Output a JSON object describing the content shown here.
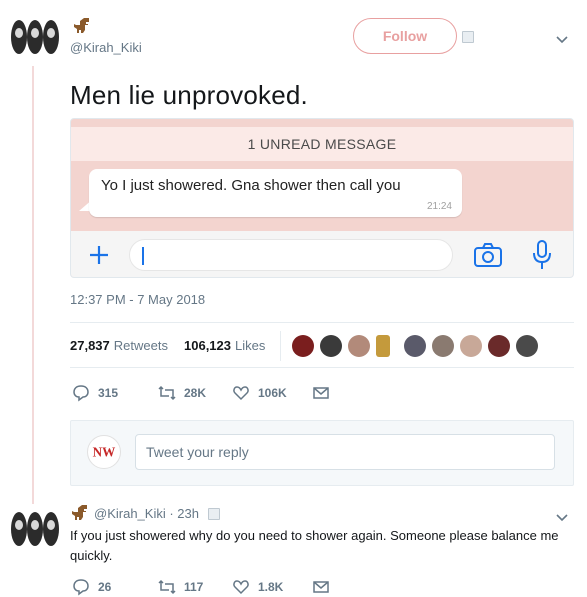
{
  "tweet": {
    "handle": "@Kirah_Kiki",
    "follow_label": "Follow",
    "text": "Men lie unprovoked.",
    "timestamp": "12:37 PM - 7 May 2018",
    "retweets_count": "27,837",
    "retweets_label": "Retweets",
    "likes_count": "106,123",
    "likes_label": "Likes",
    "actions": {
      "replies": "315",
      "retweets": "28K",
      "likes": "106K"
    }
  },
  "chat_image": {
    "unread_label": "1 UNREAD MESSAGE",
    "message": "Yo I just showered. Gna shower then call you",
    "message_time": "21:24"
  },
  "reply_box": {
    "placeholder": "Tweet your reply",
    "logo_text": "NW"
  },
  "reply_tweet": {
    "handle_line": "@Kirah_Kiki · 23h",
    "text": "If you just showered why do you need to shower again. Someone please balance me quickly.",
    "actions": {
      "replies": "26",
      "retweets": "117",
      "likes": "1.8K"
    }
  },
  "colors": {
    "accent": "#e8a0a0",
    "chat_bg": "#f3d4cf",
    "link_gray": "#657786",
    "camera_blue": "#1a73e8"
  },
  "icons": [
    "dino-icon",
    "chevron-down-icon",
    "plus-icon",
    "camera-icon",
    "mic-icon",
    "reply-icon",
    "retweet-icon",
    "heart-icon",
    "message-icon"
  ]
}
